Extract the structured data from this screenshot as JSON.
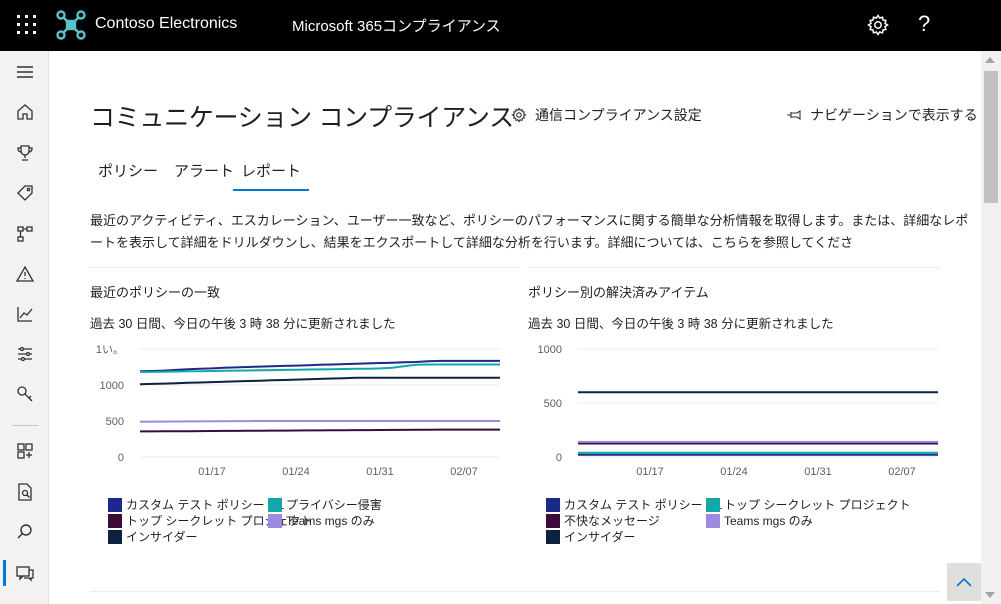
{
  "header": {
    "org_name": "Contoso Electronics",
    "app_name": "Microsoft 365コンプライアンス",
    "help_label": "?"
  },
  "rail": {
    "items": [
      "menu",
      "home",
      "trophy",
      "tag",
      "flow",
      "alert",
      "chart",
      "sliders",
      "key",
      "grid-add",
      "document-search",
      "search",
      "communication"
    ]
  },
  "page": {
    "title": "コミュニケーション コンプライアンス",
    "settings_label": "通信コンプライアンス設定",
    "nav_label": "ナビゲーションで表示する",
    "tabs": [
      {
        "label": "ポリシー"
      },
      {
        "label": "アラート"
      },
      {
        "label": "レポート"
      }
    ],
    "active_tab": "レポート",
    "description": "最近のアクティビティ、エスカレーション、ユーザー一致など、ポリシーのパフォーマンスに関する簡単な分析情報を取得します。または、詳細なレポートを表示して詳細をドリルダウンし、結果をエクスポートして詳細な分析を行います。詳細については、こちらを参照してくださ"
  },
  "cards": [
    {
      "title": "最近のポリシーの一致",
      "subtitle": "過去 30 日間、今日の午後 3 時 38 分に更新されました"
    },
    {
      "title": "ポリシー別の解決済みアイテム",
      "subtitle": "過去 30 日間、今日の午後 3 時 38 分に更新されました"
    }
  ],
  "colors": {
    "accent": "#0078d4",
    "navy": "#1b2a8a",
    "teal": "#13a8a8",
    "plum": "#3d0b38",
    "lavender": "#9b8ae0",
    "dark_navy": "#0d2240"
  },
  "chart_data": [
    {
      "type": "line",
      "ylim": [
        0,
        1500
      ],
      "ytick_labels": [
        "1い。",
        "1000",
        "500",
        "0"
      ],
      "xtick_labels": [
        "01/17",
        "01/24",
        "01/31",
        "02/07"
      ],
      "x": [
        0,
        1,
        2,
        3,
        4,
        5,
        6,
        7,
        8,
        9,
        10,
        11,
        12,
        13,
        14,
        15,
        16,
        17,
        18,
        19,
        20,
        21,
        22,
        23,
        24,
        25,
        26,
        27,
        28,
        29,
        30
      ],
      "series": [
        {
          "name": "カスタム テスト ポリシー OL",
          "color": "#1b2a8a",
          "values": [
            1190,
            1195,
            1200,
            1210,
            1220,
            1225,
            1230,
            1240,
            1245,
            1250,
            1255,
            1260,
            1265,
            1270,
            1275,
            1280,
            1285,
            1290,
            1295,
            1300,
            1305,
            1310,
            1315,
            1320,
            1330,
            1335,
            1335,
            1335,
            1335,
            1335,
            1335
          ]
        },
        {
          "name": "プライバシー侵害",
          "color": "#13a8a8",
          "values": [
            1180,
            1182,
            1185,
            1187,
            1190,
            1192,
            1195,
            1197,
            1200,
            1202,
            1205,
            1207,
            1210,
            1212,
            1215,
            1217,
            1220,
            1222,
            1225,
            1227,
            1230,
            1240,
            1260,
            1280,
            1285,
            1285,
            1285,
            1285,
            1285,
            1285,
            1285
          ]
        },
        {
          "name": "トップ シークレット プロジェクト",
          "color": "#3d0b38",
          "values": [
            355,
            356,
            357,
            358,
            359,
            360,
            361,
            362,
            363,
            364,
            365,
            366,
            367,
            368,
            369,
            370,
            371,
            372,
            373,
            374,
            375,
            376,
            377,
            378,
            379,
            380,
            380,
            380,
            380,
            380,
            380
          ]
        },
        {
          "name": "Teams mgs のみ",
          "color": "#9b8ae0",
          "values": [
            490,
            491,
            492,
            493,
            494,
            495,
            496,
            497,
            498,
            499,
            500,
            500,
            500,
            500,
            500,
            500,
            500,
            500,
            500,
            500,
            500,
            500,
            500,
            500,
            500,
            500,
            500,
            500,
            500,
            500,
            500
          ]
        },
        {
          "name": "インサイダー",
          "color": "#0d2240",
          "values": [
            1010,
            1015,
            1020,
            1025,
            1030,
            1035,
            1040,
            1045,
            1050,
            1055,
            1060,
            1065,
            1070,
            1075,
            1080,
            1085,
            1090,
            1095,
            1100,
            1100,
            1100,
            1100,
            1100,
            1100,
            1100,
            1100,
            1100,
            1100,
            1100,
            1100,
            1100
          ]
        }
      ]
    },
    {
      "type": "line",
      "ylim": [
        0,
        1000
      ],
      "ytick_labels": [
        "1000",
        "500",
        "0"
      ],
      "xtick_labels": [
        "01/17",
        "01/24",
        "01/31",
        "02/07"
      ],
      "x": [
        0,
        1,
        2,
        3,
        4,
        5,
        6,
        7,
        8,
        9,
        10,
        11,
        12,
        13,
        14,
        15,
        16,
        17,
        18,
        19,
        20,
        21,
        22,
        23,
        24,
        25,
        26,
        27,
        28,
        29,
        30
      ],
      "series": [
        {
          "name": "カスタム テスト ポリシー OL",
          "color": "#1b2a8a",
          "values": [
            20,
            20,
            20,
            20,
            20,
            20,
            20,
            20,
            20,
            20,
            20,
            20,
            20,
            20,
            20,
            20,
            20,
            20,
            20,
            20,
            20,
            20,
            20,
            20,
            20,
            20,
            20,
            20,
            20,
            20,
            20
          ]
        },
        {
          "name": "トップ シークレット プロジェクト",
          "color": "#13a8a8",
          "values": [
            40,
            40,
            40,
            40,
            40,
            40,
            40,
            40,
            40,
            40,
            40,
            40,
            40,
            40,
            40,
            40,
            40,
            40,
            40,
            40,
            40,
            40,
            40,
            40,
            40,
            40,
            40,
            40,
            40,
            40,
            40
          ]
        },
        {
          "name": "不快なメッセージ",
          "color": "#3d0b38",
          "values": [
            125,
            125,
            125,
            125,
            125,
            125,
            125,
            125,
            125,
            125,
            125,
            125,
            125,
            125,
            125,
            125,
            125,
            125,
            125,
            125,
            125,
            125,
            125,
            125,
            125,
            125,
            125,
            125,
            125,
            125,
            125
          ]
        },
        {
          "name": "Teams mgs のみ",
          "color": "#9b8ae0",
          "values": [
            140,
            140,
            140,
            140,
            140,
            140,
            140,
            140,
            140,
            140,
            140,
            140,
            140,
            140,
            140,
            140,
            140,
            140,
            140,
            140,
            140,
            140,
            140,
            140,
            140,
            140,
            140,
            140,
            140,
            140,
            140
          ]
        },
        {
          "name": "インサイダー",
          "color": "#0d2240",
          "values": [
            600,
            600,
            600,
            600,
            600,
            600,
            600,
            600,
            600,
            600,
            600,
            600,
            600,
            600,
            600,
            600,
            600,
            600,
            600,
            600,
            600,
            600,
            600,
            600,
            600,
            600,
            600,
            600,
            600,
            600,
            600
          ]
        }
      ]
    }
  ]
}
